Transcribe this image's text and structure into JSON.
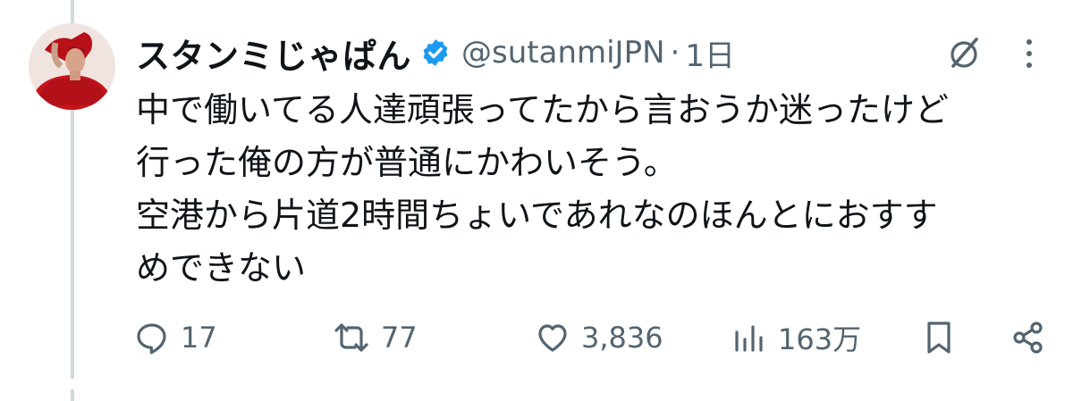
{
  "tweet": {
    "display_name": "スタンミじゃぱん",
    "handle": "@sutanmiJPN",
    "separator": "·",
    "time": "1日",
    "text_lines": [
      "中で働いてる人達頑張ってたから言おうか迷ったけど",
      "行った俺の方が普通にかわいそう。",
      "空港から片道2時間ちょいであれなのほんとにおすす",
      "めできない"
    ]
  },
  "metrics": {
    "replies": "17",
    "reposts": "77",
    "likes": "3,836",
    "views": "163万"
  },
  "icons": {
    "verified": "verified-badge-icon",
    "grok": "grok-icon",
    "more": "more-vertical-icon",
    "reply": "reply-icon",
    "repost": "repost-icon",
    "like": "heart-icon",
    "views": "views-bar-chart-icon",
    "bookmark": "bookmark-icon",
    "share": "share-icon"
  },
  "colors": {
    "text": "#0f1419",
    "secondary": "#536471",
    "verified": "#1d9bf0",
    "thread_line": "#cfd9de"
  }
}
